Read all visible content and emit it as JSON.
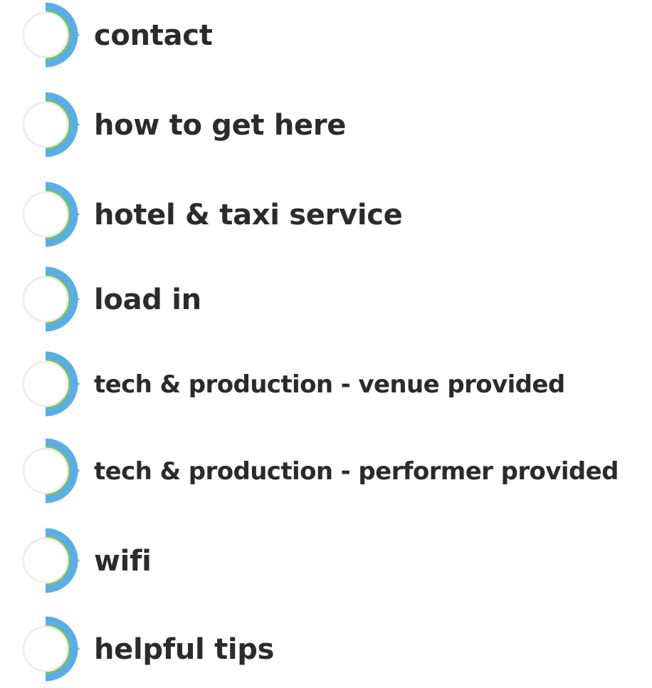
{
  "menu": {
    "items": [
      {
        "label": "contact"
      },
      {
        "label": "how to get here"
      },
      {
        "label": "hotel & taxi service"
      },
      {
        "label": "load in"
      },
      {
        "label": "tech & production - venue provided"
      },
      {
        "label": "tech & production - performer provided"
      },
      {
        "label": "wifi"
      },
      {
        "label": "helpful tips"
      }
    ]
  },
  "colors": {
    "ring_blue": "#5aaee3",
    "ring_green": "#7cc242",
    "ring_gray": "#eeeeee",
    "text": "#2b2b2b",
    "background": "#ffffff"
  },
  "icon": "chevron-circle-icon"
}
